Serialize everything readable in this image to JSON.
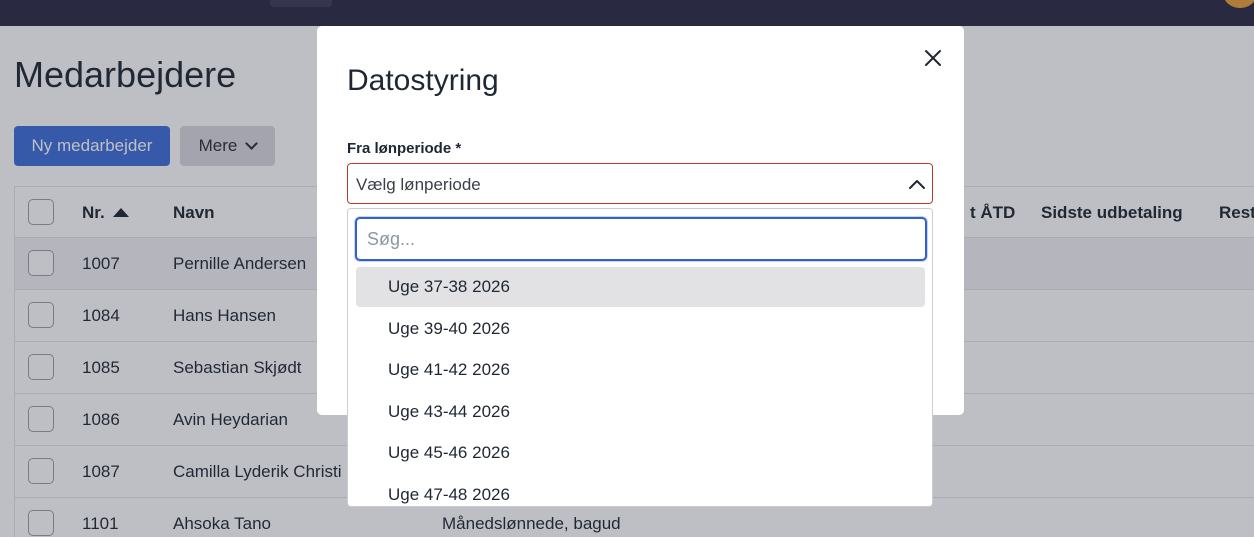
{
  "page": {
    "title": "Medarbejdere",
    "new_employee_button": "Ny medarbejder",
    "more_button": "Mere"
  },
  "table": {
    "headers": {
      "nr": "Nr.",
      "name": "Navn",
      "hidden_col": "t ÅTD",
      "last_payment": "Sidste udbetaling",
      "rest": "Rest"
    },
    "rows": [
      {
        "nr": "1007",
        "name": "Pernille Andersen",
        "type": ""
      },
      {
        "nr": "1084",
        "name": "Hans Hansen",
        "type": ""
      },
      {
        "nr": "1085",
        "name": "Sebastian Skjødt",
        "type": ""
      },
      {
        "nr": "1086",
        "name": "Avin Heydarian",
        "type": ""
      },
      {
        "nr": "1087",
        "name": "Camilla Lyderik Christi",
        "type": ""
      },
      {
        "nr": "1101",
        "name": "Ahsoka Tano",
        "type": "Månedslønnede, bagud"
      }
    ]
  },
  "modal": {
    "title": "Datostyring",
    "field_label": "Fra lønperiode *",
    "select_value": "Vælg lønperiode",
    "search_placeholder": "Søg...",
    "options": [
      "Uge 37-38 2026",
      "Uge 39-40 2026",
      "Uge 41-42 2026",
      "Uge 43-44 2026",
      "Uge 45-46 2026",
      "Uge 47-48 2026"
    ]
  },
  "colors": {
    "topbar": "#2a2a44",
    "primary": "#3d6fd8",
    "error_border": "#c0392b",
    "focus": "#3461c9"
  }
}
